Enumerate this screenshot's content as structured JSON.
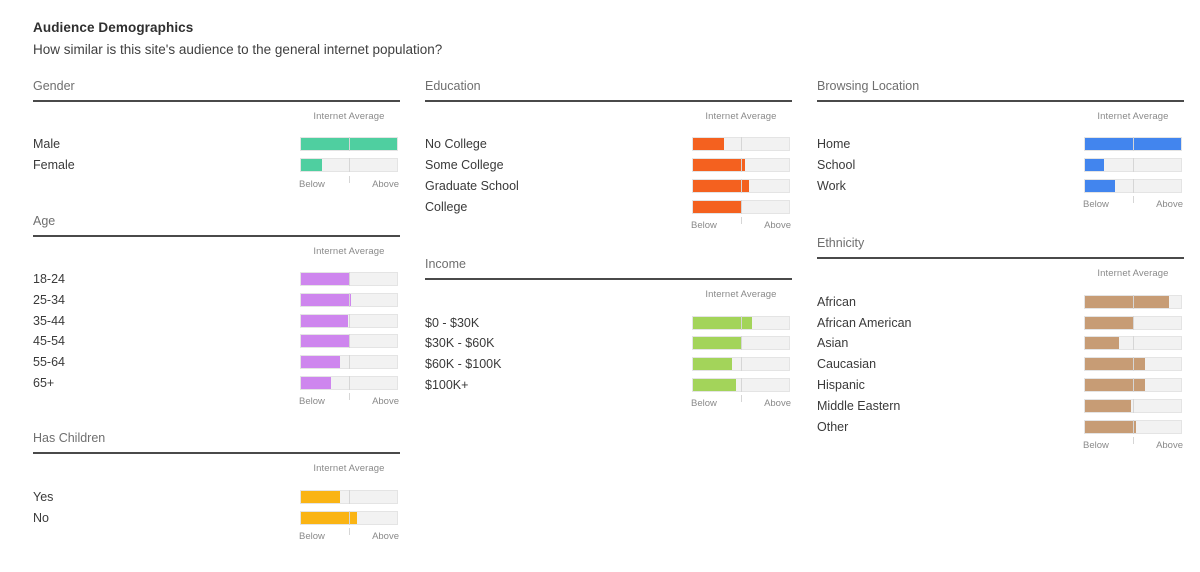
{
  "header": {
    "title": "Audience Demographics",
    "subtitle": "How similar is this site's audience to the general internet population?"
  },
  "labels": {
    "internet_average": "Internet Average",
    "below": "Below",
    "above": "Above"
  },
  "colors": {
    "gender": "#4fcfa0",
    "age": "#ce86ee",
    "has_children": "#fab414",
    "education": "#f4611f",
    "income": "#a3d45a",
    "browsing_location": "#4285ee",
    "ethnicity": "#c79c75",
    "track_bg": "#f2f2f2",
    "track_border": "#e4e4e4",
    "midline": "#d6d6d6",
    "rule": "#4a4a4a",
    "panel_title": "#6f6f6f",
    "axis_text": "#8a8a8a"
  },
  "chart_data": {
    "type": "bar",
    "title": "Audience Demographics",
    "subtitle": "How similar is this site's audience to the general internet population?",
    "xlabel": "Internet Average",
    "ylabel": "",
    "xlim": [
      0,
      100
    ],
    "axis_center_pct": 50,
    "axis_tick_labels": [
      "Below",
      "Above"
    ],
    "grid": false,
    "legend": "none",
    "note": "Each bar is drawn on a 0-100 track; 50 marks the internet average. value_pct is the measured bar width as a percent of the full track.",
    "panels": [
      {
        "name": "Gender",
        "color": "#4fcfa0",
        "categories": [
          "Male",
          "Female"
        ],
        "values_pct": [
          100,
          22
        ]
      },
      {
        "name": "Age",
        "color": "#ce86ee",
        "categories": [
          "18-24",
          "25-34",
          "35-44",
          "45-54",
          "55-64",
          "65+"
        ],
        "values_pct": [
          50,
          52,
          49,
          51,
          41,
          31
        ]
      },
      {
        "name": "Has Children",
        "color": "#fab414",
        "categories": [
          "Yes",
          "No"
        ],
        "values_pct": [
          41,
          58
        ]
      },
      {
        "name": "Education",
        "color": "#f4611f",
        "categories": [
          "No College",
          "Some College",
          "Graduate School",
          "College"
        ],
        "values_pct": [
          32,
          54,
          58,
          50
        ]
      },
      {
        "name": "Income",
        "color": "#a3d45a",
        "categories": [
          "$0 - $30K",
          "$30K - $60K",
          "$60K - $100K",
          "$100K+"
        ],
        "values_pct": [
          61,
          51,
          41,
          45
        ]
      },
      {
        "name": "Browsing Location",
        "color": "#4285ee",
        "categories": [
          "Home",
          "School",
          "Work"
        ],
        "values_pct": [
          100,
          20,
          31
        ]
      },
      {
        "name": "Ethnicity",
        "color": "#c79c75",
        "categories": [
          "African",
          "African American",
          "Asian",
          "Caucasian",
          "Hispanic",
          "Middle Eastern",
          "Other"
        ],
        "values_pct": [
          87,
          51,
          35,
          62,
          63,
          48,
          53
        ]
      }
    ]
  }
}
